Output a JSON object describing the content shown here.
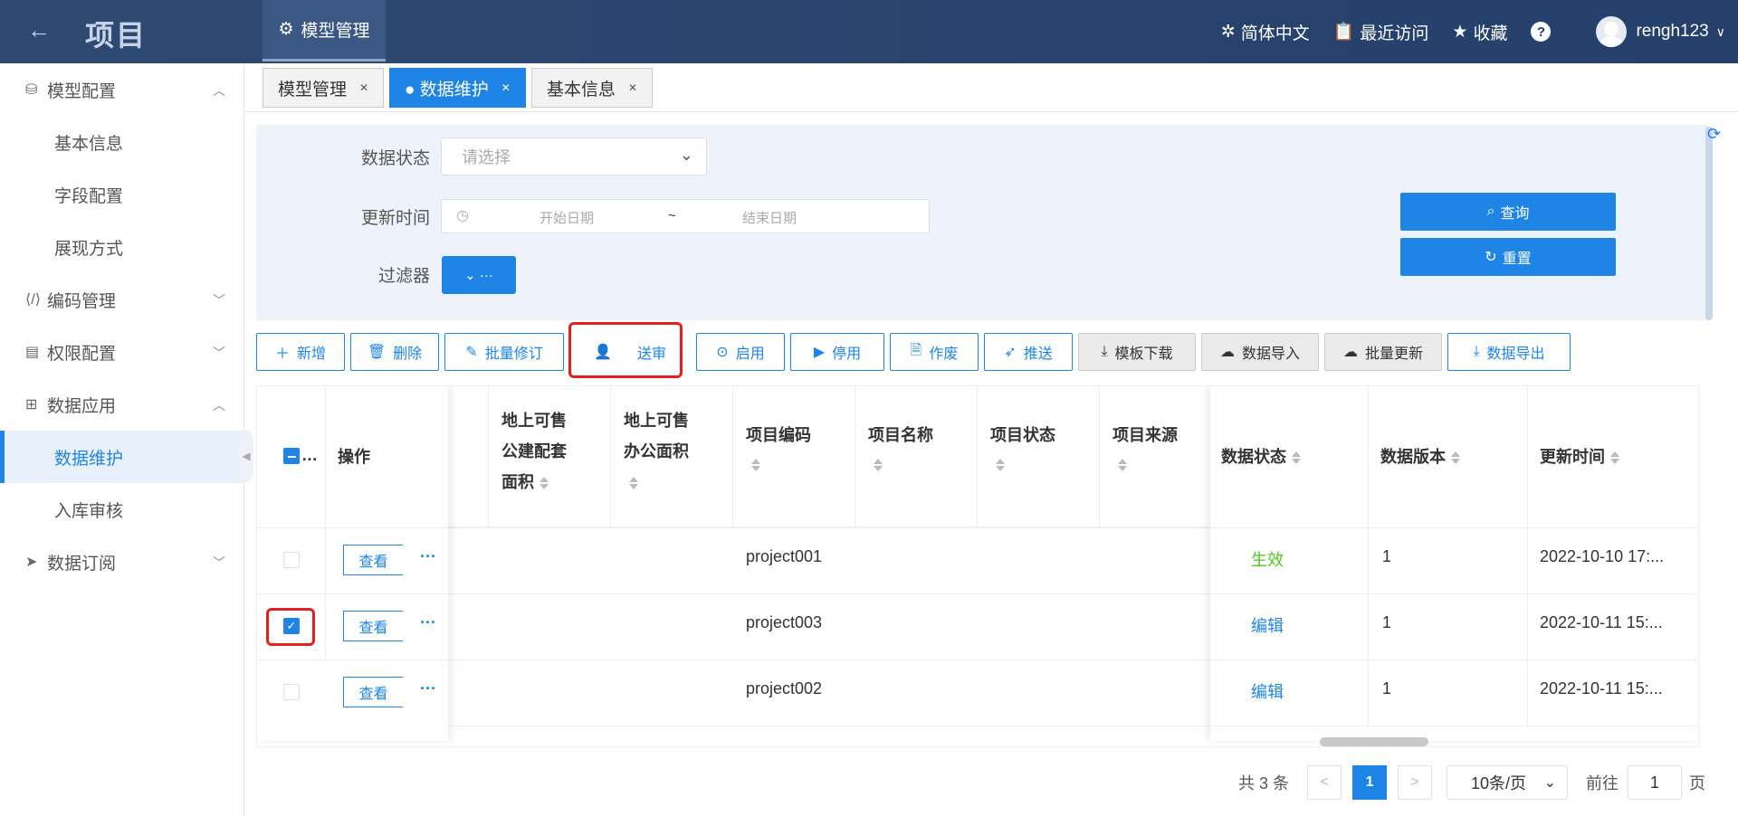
{
  "topbar": {
    "back_icon": "arrow-left-icon",
    "title": "项目",
    "active_menu": "模型管理",
    "language": "简体中文",
    "recent": "最近访问",
    "favorites": "收藏",
    "help": "?",
    "username": "rengh123"
  },
  "sidebar": {
    "groups": [
      {
        "label": "模型配置",
        "icon": "model-icon",
        "expanded": true,
        "children": [
          "基本信息",
          "字段配置",
          "展现方式"
        ]
      },
      {
        "label": "编码管理",
        "icon": "code-icon",
        "expanded": false
      },
      {
        "label": "权限配置",
        "icon": "permission-icon",
        "expanded": false
      },
      {
        "label": "数据应用",
        "icon": "apps-icon",
        "expanded": true,
        "children": [
          "数据维护",
          "入库审核"
        ]
      },
      {
        "label": "数据订阅",
        "icon": "send-icon",
        "expanded": false
      }
    ],
    "active_item": "数据维护"
  },
  "tabs": [
    {
      "label": "模型管理",
      "active": false
    },
    {
      "label": "● 数据维护",
      "active": true
    },
    {
      "label": "基本信息",
      "active": false
    }
  ],
  "filter": {
    "status_label": "数据状态",
    "status_placeholder": "请选择",
    "time_label": "更新时间",
    "start_placeholder": "开始日期",
    "separator": "~",
    "end_placeholder": "结束日期",
    "filter_label": "过滤器",
    "filter_button": "⌄ ···",
    "query": "查询",
    "reset": "重置"
  },
  "toolbar": {
    "buttons": [
      "新增",
      "删除",
      "批量修订",
      "送审",
      "启用",
      "停用",
      "作废",
      "推送",
      "模板下载",
      "数据导入",
      "批量更新",
      "数据导出"
    ]
  },
  "table": {
    "headers": {
      "select": "…",
      "action": "操作",
      "col_a1": "地上可售",
      "col_a2": "公建配套",
      "col_a3": "面积",
      "col_b1": "地上可售",
      "col_b2": "办公面积",
      "code": "项目编码",
      "name": "项目名称",
      "state": "项目状态",
      "source": "项目来源",
      "data_status": "数据状态",
      "version": "数据版本",
      "updated": "更新时间"
    },
    "view_label": "查看",
    "more_label": "···",
    "rows": [
      {
        "checked": false,
        "code": "project001",
        "status": "生效",
        "status_color": "#52c41a",
        "version": "1",
        "updated": "2022-10-10 17:..."
      },
      {
        "checked": true,
        "code": "project003",
        "status": "编辑",
        "status_color": "#1e84e6",
        "version": "1",
        "updated": "2022-10-11 15:..."
      },
      {
        "checked": false,
        "code": "project002",
        "status": "编辑",
        "status_color": "#1e84e6",
        "version": "1",
        "updated": "2022-10-11 15:..."
      }
    ]
  },
  "pagination": {
    "total": "共 3 条",
    "prev": "<",
    "current": "1",
    "next": ">",
    "page_size": "10条/页",
    "goto_label": "前往",
    "goto_value": "1",
    "page_suffix": "页"
  },
  "colors": {
    "primary": "#1e84e6",
    "header": "#24406b",
    "highlight": "#e51f1f"
  }
}
